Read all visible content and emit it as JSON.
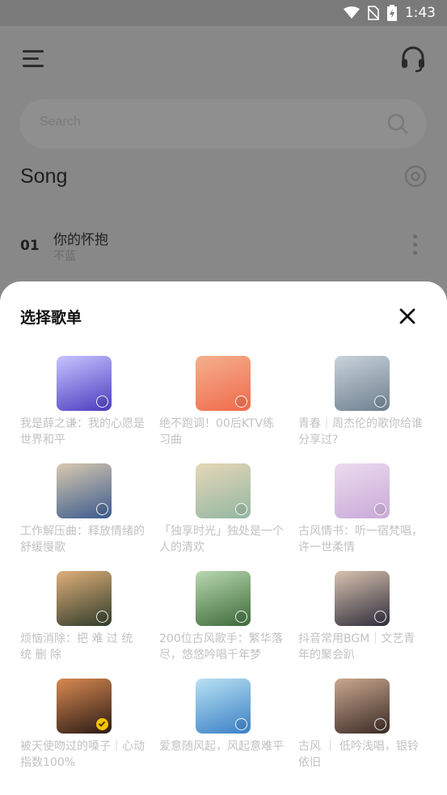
{
  "status_bar": {
    "time": "1:43"
  },
  "background_app": {
    "search_placeholder": "Search",
    "section_title": "Song",
    "song": {
      "number": "01",
      "title": "你的怀抱",
      "artist": "不蓝"
    }
  },
  "sheet": {
    "title": "选择歌单",
    "playlists": [
      {
        "label": "我是薛之谦：我的心愿是世界和平",
        "selected": false,
        "cover_colors": [
          "#4b3bbf",
          "#c8c4ff"
        ]
      },
      {
        "label": "绝不跑调！00后KTV练习曲",
        "selected": false,
        "cover_colors": [
          "#ef6a4b",
          "#f5b08e"
        ]
      },
      {
        "label": "青春｜周杰伦的歌你给谁分享过?",
        "selected": false,
        "cover_colors": [
          "#6e7f8e",
          "#c9d3db"
        ]
      },
      {
        "label": "工作解压曲：释放情绪的舒缓慢歌",
        "selected": false,
        "cover_colors": [
          "#3a5a8e",
          "#d9c9b0"
        ]
      },
      {
        "label": "「独享时光」独处是一个人的清欢",
        "selected": false,
        "cover_colors": [
          "#93b7a2",
          "#e6d7b8"
        ]
      },
      {
        "label": "古风情书：听一宿梵唱，许一世柔情",
        "selected": false,
        "cover_colors": [
          "#c8a9d8",
          "#ecdcee"
        ]
      },
      {
        "label": "烦恼消除：把 难 过 统 统 删 除",
        "selected": false,
        "cover_colors": [
          "#2f3b2a",
          "#e0b07a"
        ]
      },
      {
        "label": "200位古风歌手：繁华落尽，悠悠吟唱千年梦",
        "selected": false,
        "cover_colors": [
          "#3c6a3a",
          "#b9d8b0"
        ]
      },
      {
        "label": "抖音常用BGM｜文艺青年的聚会趴",
        "selected": false,
        "cover_colors": [
          "#2d2d3a",
          "#d9c2b0"
        ]
      },
      {
        "label": "被天使吻过的嗓子｜心动指数100%",
        "selected": true,
        "cover_colors": [
          "#2a1a14",
          "#d98a52"
        ]
      },
      {
        "label": "爱意随风起，风起意难平",
        "selected": false,
        "cover_colors": [
          "#3a7fc6",
          "#b9e2f2"
        ]
      },
      {
        "label": "古风 ｜ 低吟浅唱，银铃依旧",
        "selected": false,
        "cover_colors": [
          "#3a2a26",
          "#c9a88e"
        ]
      }
    ]
  }
}
